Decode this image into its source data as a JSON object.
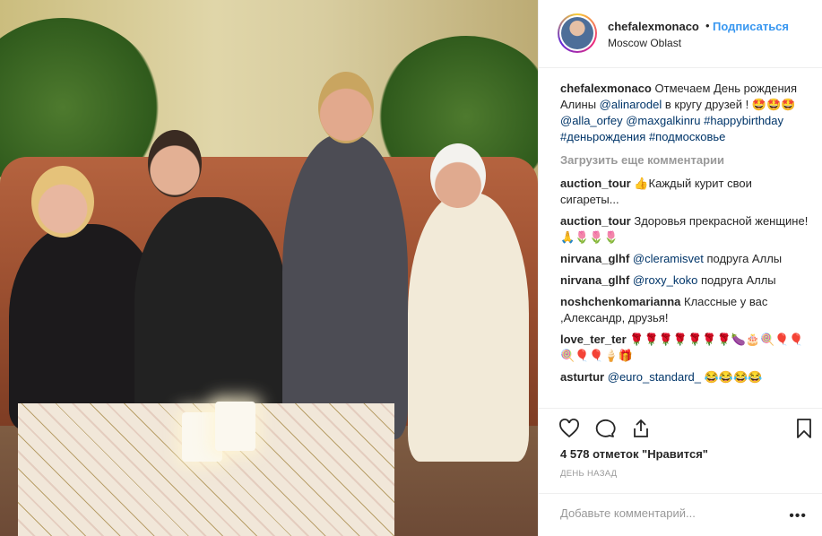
{
  "post": {
    "photo_alt": "",
    "username": "chefalexmonaco",
    "separator": "•",
    "follow_label": "Подписаться",
    "location": "Moscow Oblast"
  },
  "caption": {
    "username": "chefalexmonaco",
    "text_1": "Отмечаем День рождения Алины",
    "mention_1": "@alinarodel",
    "text_2": "в кругу друзей ! 🤩🤩🤩",
    "mention_2": "@alla_orfey",
    "mention_3": "@maxgalkinru",
    "tag_1": "#happybirthday",
    "tag_2": "#деньрождения",
    "tag_3": "#подмосковье"
  },
  "load_more_label": "Загрузить еще комментарии",
  "comments": [
    {
      "user": "auction_tour",
      "mention": "",
      "text": "👍Каждый курит свои сигареты..."
    },
    {
      "user": "auction_tour",
      "mention": "",
      "text": "Здоровья прекрасной женщине!🙏🌷🌷🌷"
    },
    {
      "user": "nirvana_glhf",
      "mention": "@cleramisvet",
      "text": "подруга Аллы"
    },
    {
      "user": "nirvana_glhf",
      "mention": "@roxy_koko",
      "text": "подруга Аллы"
    },
    {
      "user": "noshchenkomarianna",
      "mention": "",
      "text": "Классные у вас ,Александр, друзья!"
    },
    {
      "user": "love_ter_ter",
      "mention": "",
      "text": "🌹🌹🌹🌹🌹🌹🌹🍆🎂🍭🎈🎈🍭🎈🎈🍦🎁"
    },
    {
      "user": "asturtur",
      "mention": "@euro_standard_",
      "text": "😂😂😂😂"
    }
  ],
  "actions": {
    "like_icon": "heart-icon",
    "comment_icon": "comment-icon",
    "share_icon": "share-icon",
    "save_icon": "bookmark-icon"
  },
  "likes_label": "4 578 отметок \"Нравится\"",
  "timestamp": "ДЕНЬ НАЗАД",
  "add_comment_placeholder": "Добавьте комментарий...",
  "more_label": "•••",
  "colors": {
    "accent": "#3897f0",
    "mention": "#003569",
    "muted": "#999999",
    "text": "#262626"
  }
}
